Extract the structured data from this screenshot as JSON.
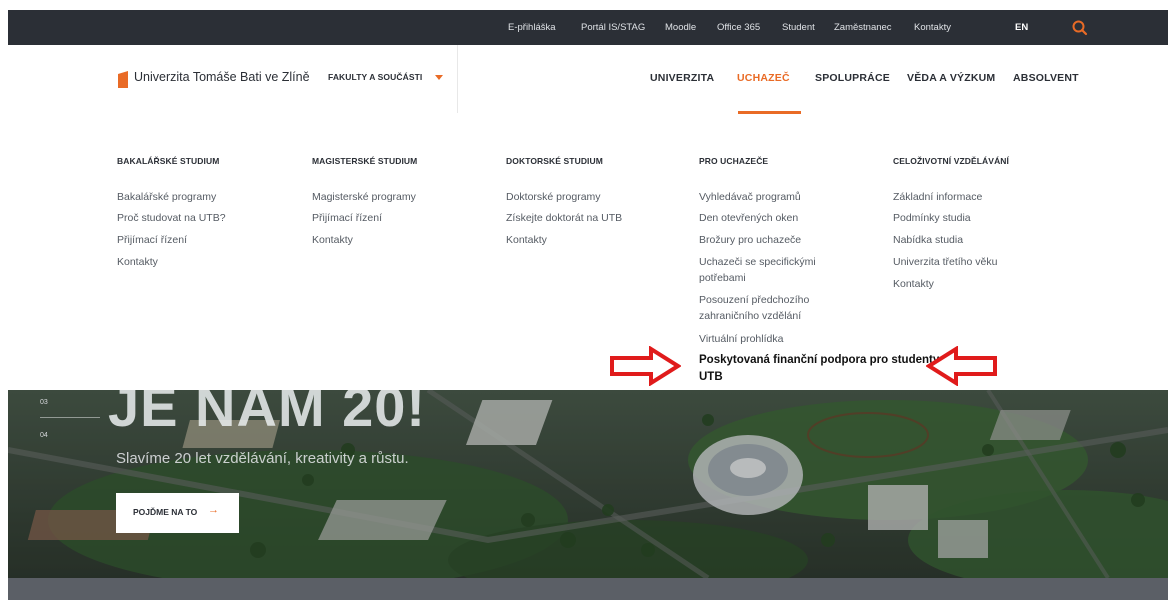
{
  "topbar": {
    "links": [
      "E-přihláška",
      "Portál IS/STAG",
      "Moodle",
      "Office 365",
      "Student",
      "Zaměstnanec",
      "Kontakty"
    ],
    "lang": "EN",
    "search_icon": "search-icon"
  },
  "header": {
    "brand": "Univerzita Tomáše Bati ve Zlíně",
    "faculties": "FAKULTY A SOUČÁSTI",
    "nav": [
      "UNIVERZITA",
      "UCHAZEČ",
      "SPOLUPRÁCE",
      "VĚDA A VÝZKUM",
      "ABSOLVENT"
    ],
    "active_nav": "UCHAZEČ",
    "accent_color": "#e96b26"
  },
  "menu": {
    "columns": [
      {
        "heading": "BAKALÁŘSKÉ STUDIUM",
        "links": [
          "Bakalářské programy",
          "Proč studovat na UTB?",
          "Přijímací řízení",
          "Kontakty"
        ]
      },
      {
        "heading": "MAGISTERSKÉ STUDIUM",
        "links": [
          "Magisterské programy",
          "Přijímací řízení",
          "Kontakty"
        ]
      },
      {
        "heading": "DOKTORSKÉ STUDIUM",
        "links": [
          "Doktorské programy",
          "Získejte doktorát na UTB",
          "Kontakty"
        ]
      },
      {
        "heading": "PRO UCHAZEČE",
        "links": [
          "Vyhledávač programů",
          "Den otevřených oken",
          "Brožury pro uchazeče",
          "Uchazeči se specifickými potřebami",
          "Posouzení předchozího zahraničního vzdělání",
          "Virtuální prohlídka",
          "Poskytovaná finanční podpora pro studenty UTB"
        ]
      },
      {
        "heading": "CELOŽIVOTNÍ VZDĚLÁVÁNÍ",
        "links": [
          "Základní informace",
          "Podmínky studia",
          "Nabídka studia",
          "Univerzita třetího věku",
          "Kontakty"
        ]
      }
    ]
  },
  "hero": {
    "title": "JE NÁM 20!",
    "subtitle": "Slavíme 20 let vzdělávání, kreativity a růstu.",
    "button": "POJĎME NA TO",
    "slides": [
      "03",
      "04"
    ]
  },
  "annotation": {
    "arrow_color": "#e01b1b"
  }
}
